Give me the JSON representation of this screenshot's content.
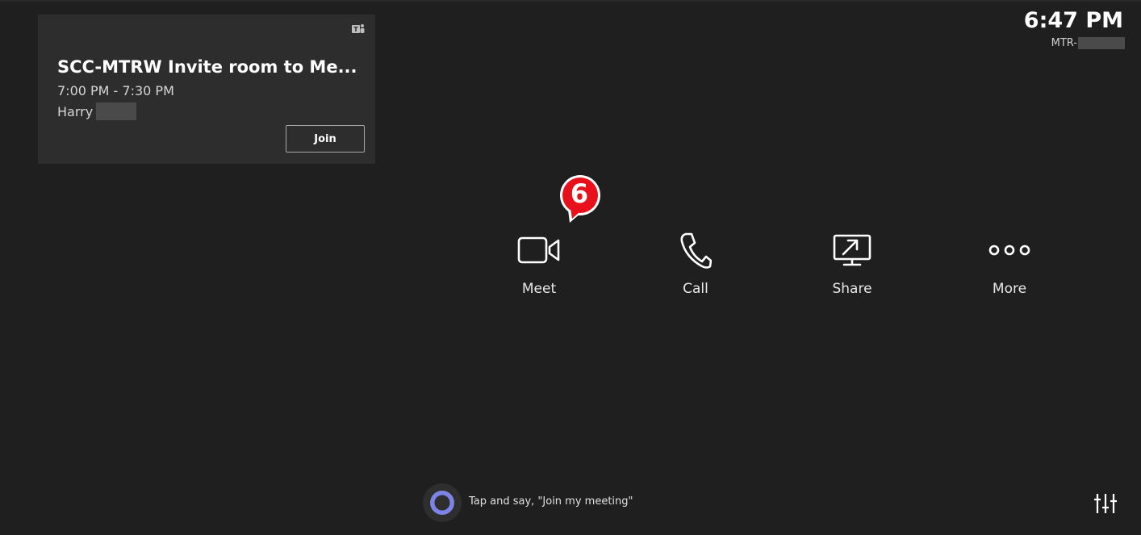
{
  "meeting": {
    "title": "SCC-MTRW Invite room to Me...",
    "time": "7:00 PM - 7:30 PM",
    "organizer": "Harry",
    "join_label": "Join",
    "icon": "teams-icon"
  },
  "status": {
    "time": "6:47 PM",
    "device_prefix": "MTR-"
  },
  "actions": [
    {
      "label": "Meet",
      "icon": "video-camera-icon"
    },
    {
      "label": "Call",
      "icon": "phone-icon"
    },
    {
      "label": "Share",
      "icon": "screen-share-icon"
    },
    {
      "label": "More",
      "icon": "more-dots-icon"
    }
  ],
  "annotation": {
    "step": "6",
    "color": "#e8101a"
  },
  "cortana": {
    "prompt": "Tap and say, \"Join my meeting\"",
    "icon": "cortana-icon",
    "accent": "#7b83eb"
  },
  "settings": {
    "icon": "settings-sliders-icon"
  },
  "colors": {
    "background": "#1f1f1f",
    "card": "#2d2d2d",
    "text": "#ffffff"
  }
}
